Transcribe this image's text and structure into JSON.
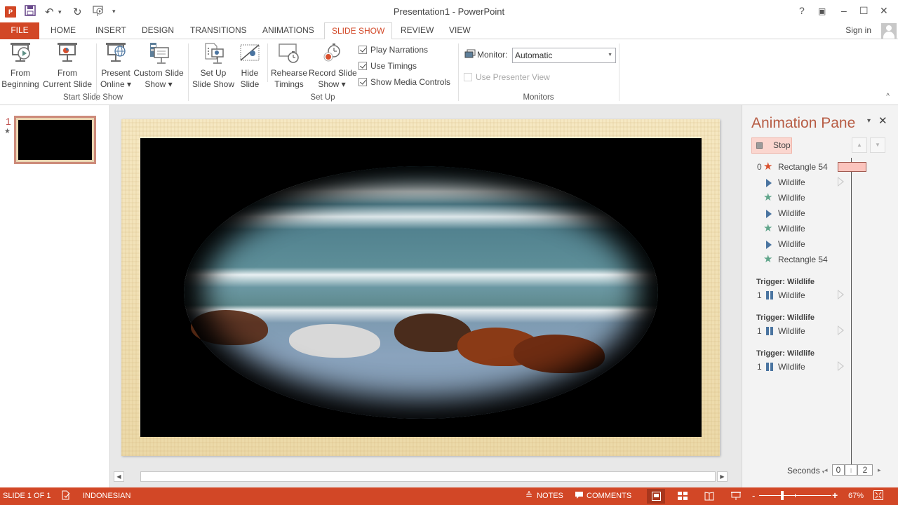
{
  "window": {
    "title": "Presentation1 - PowerPoint",
    "app_icon": "P",
    "controls": {
      "help": "?",
      "ribbon_display": "▣",
      "minimize": "–",
      "maximize": "☐",
      "close": "✕"
    }
  },
  "quick_access": {
    "save": "save-icon",
    "undo": "↶",
    "undo_more": "▾",
    "redo": "↻",
    "present": "present-icon",
    "customize": "▾"
  },
  "tabs": [
    {
      "label": "FILE"
    },
    {
      "label": "HOME"
    },
    {
      "label": "INSERT"
    },
    {
      "label": "DESIGN"
    },
    {
      "label": "TRANSITIONS"
    },
    {
      "label": "ANIMATIONS"
    },
    {
      "label": "SLIDE SHOW",
      "active": true
    },
    {
      "label": "REVIEW"
    },
    {
      "label": "VIEW"
    }
  ],
  "account": {
    "sign_in": "Sign in"
  },
  "ribbon": {
    "groups": {
      "start_slide_show": "Start Slide Show",
      "set_up": "Set Up",
      "monitors": "Monitors"
    },
    "buttons": {
      "from_beginning": [
        "From",
        "Beginning"
      ],
      "from_current": [
        "From",
        "Current Slide"
      ],
      "present_online": [
        "Present",
        "Online ▾"
      ],
      "custom_slide_show": [
        "Custom Slide",
        "Show ▾"
      ],
      "set_up_slide_show": [
        "Set Up",
        "Slide Show"
      ],
      "hide_slide": [
        "Hide",
        "Slide"
      ],
      "rehearse_timings": [
        "Rehearse",
        "Timings"
      ],
      "record_slide_show": [
        "Record Slide",
        "Show ▾"
      ]
    },
    "checkboxes": [
      {
        "label": "Play Narrations",
        "checked": true
      },
      {
        "label": "Use Timings",
        "checked": true
      },
      {
        "label": "Show Media Controls",
        "checked": true
      }
    ],
    "monitor_label": "Monitor:",
    "monitor_value": "Automatic",
    "presenter_view": {
      "label": "Use Presenter View",
      "checked": false,
      "disabled": true
    },
    "collapse": "^"
  },
  "thumbnails": [
    {
      "number": "1",
      "has_animation": "★"
    }
  ],
  "animation_pane": {
    "title": "Animation Pane",
    "menu": "▾",
    "close": "✕",
    "stop_label": "Stop",
    "move_up": "▲",
    "move_down": "▼",
    "items": [
      {
        "num": "0",
        "icon": "emphasis-star-red",
        "name": "Rectangle 54",
        "timing_bar": true
      },
      {
        "num": "",
        "icon": "play-triangle",
        "name": "Wildlife",
        "play_marker": true
      },
      {
        "num": "",
        "icon": "emphasis-star-green",
        "name": "Wildlife"
      },
      {
        "num": "",
        "icon": "play-triangle",
        "name": "Wildlife"
      },
      {
        "num": "",
        "icon": "emphasis-star-green",
        "name": "Wildlife"
      },
      {
        "num": "",
        "icon": "play-triangle",
        "name": "Wildlife"
      },
      {
        "num": "",
        "icon": "emphasis-star-green",
        "name": "Rectangle 54"
      }
    ],
    "triggers": [
      {
        "label": "Trigger: Wildlife",
        "num": "1",
        "icon": "pause",
        "name": "Wildlife"
      },
      {
        "label": "Trigger: Wildlife",
        "num": "1",
        "icon": "pause",
        "name": "Wildlife"
      },
      {
        "label": "Trigger: Wildlife",
        "num": "1",
        "icon": "pause",
        "name": "Wildlife"
      }
    ],
    "timeline": {
      "unit": "Seconds",
      "unit_arrow": "▾",
      "start": "0",
      "end": "2",
      "prev": "◂",
      "next": "▸"
    }
  },
  "status_bar": {
    "slide_info": "SLIDE 1 OF 1",
    "language": "INDONESIAN",
    "notes": "NOTES",
    "comments": "COMMENTS",
    "zoom_minus": "-",
    "zoom_plus": "+",
    "zoom_level": "67%"
  },
  "colors": {
    "accent": "#d24726",
    "pane_title": "#b75c44",
    "animation_blue": "#4a74a0",
    "star_green": "#5fa58a",
    "star_red": "#d9502e",
    "stop_bg": "#fbd6cf"
  }
}
